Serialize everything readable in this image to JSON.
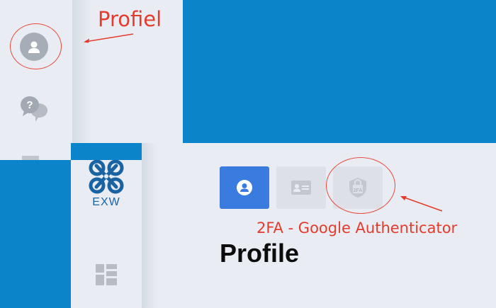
{
  "annotations": {
    "profile_label": "Profiel",
    "twofa_label": "2FA - Google Authenticator"
  },
  "sidebar": {
    "items": [
      {
        "icon": "avatar-icon"
      },
      {
        "icon": "chat-question-icon"
      },
      {
        "icon": "dashboard-icon"
      }
    ]
  },
  "brand": {
    "name": "EXW",
    "color": "#1a63a3"
  },
  "profile_tabs": [
    {
      "icon": "user-icon",
      "active": true
    },
    {
      "icon": "id-card-icon",
      "active": false
    },
    {
      "icon": "shield-2fa-icon",
      "badge": "2FA",
      "active": false
    }
  ],
  "page": {
    "title": "Profile"
  },
  "colors": {
    "background": "#0b84c9",
    "panel": "#e9edf3",
    "accent": "#3a7be0",
    "annotation": "#e53b2c"
  }
}
